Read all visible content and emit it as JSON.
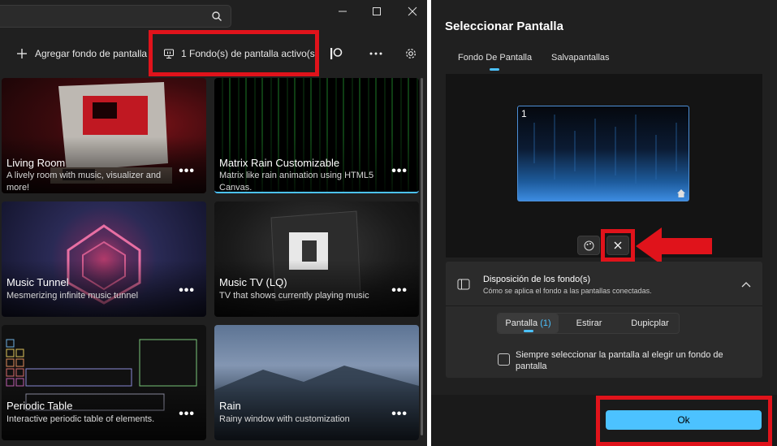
{
  "left_window": {
    "search": {
      "icon": "search-icon"
    },
    "window_controls": [
      "minimize-icon",
      "maximize-icon",
      "close-icon"
    ],
    "toolbar": {
      "add_wallpaper_label": "Agregar fondo de pantalla",
      "active_wallpapers_label": "1 Fondo(s) de pantalla activo(s)",
      "icons": [
        "plus-icon",
        "monitor-icon",
        "patreon-icon",
        "more-icon",
        "gear-icon"
      ]
    },
    "cards": [
      {
        "title": "Living Room",
        "description": "A lively room with music, visualizer and more!"
      },
      {
        "title": "Matrix Rain Customizable",
        "description": "Matrix like rain animation using HTML5 Canvas."
      },
      {
        "title": "Music Tunnel",
        "description": "Mesmerizing infinite music tunnel"
      },
      {
        "title": "Music TV (LQ)",
        "description": "TV that shows currently playing music"
      },
      {
        "title": "Periodic Table",
        "description": "Interactive periodic table of elements."
      },
      {
        "title": "Rain",
        "description": "Rainy window with customization"
      }
    ],
    "more_label": "•••"
  },
  "dialog": {
    "title": "Seleccionar Pantalla",
    "tabs": [
      "Fondo De Pantalla",
      "Salvapantallas"
    ],
    "monitor_number": "1",
    "layout": {
      "title": "Disposición de los fondo(s)",
      "subtitle": "Cómo se aplica el fondo a las pantallas conectadas.",
      "options": [
        "Pantalla",
        "Estirar",
        "Dupicplar"
      ],
      "screen_count": "(1)",
      "checkbox_label": "Siempre seleccionar la pantalla al elegir un fondo de pantalla"
    },
    "ok_label": "Ok"
  },
  "colors": {
    "highlight": "#e0131b",
    "accent": "#4cc2ff"
  }
}
